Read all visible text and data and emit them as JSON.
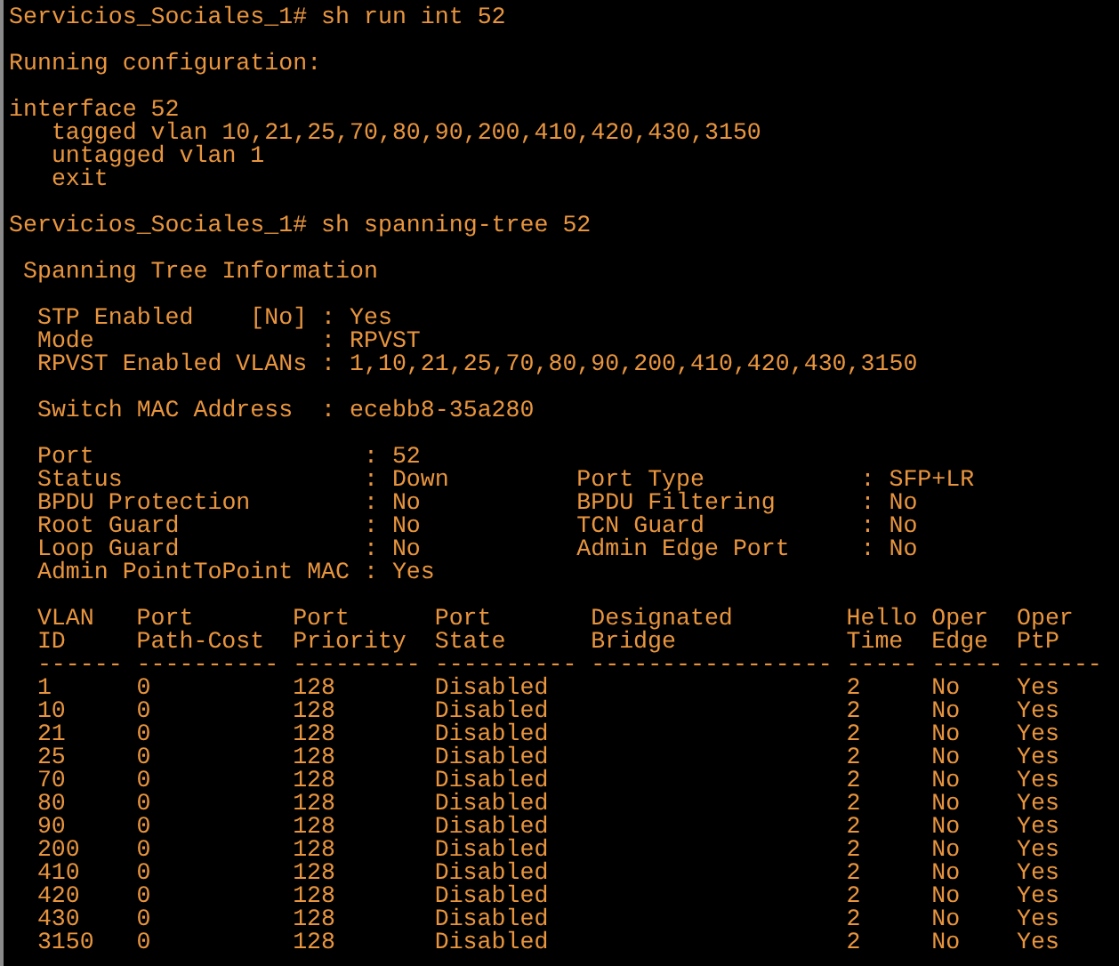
{
  "lines": [
    {
      "kind": "text",
      "text": "Servicios_Sociales_1# sh run int 52"
    },
    {
      "kind": "blank"
    },
    {
      "kind": "text",
      "text": "Running configuration:"
    },
    {
      "kind": "blank"
    },
    {
      "kind": "text",
      "text": "interface 52"
    },
    {
      "kind": "text",
      "text": "   tagged vlan 10,21,25,70,80,90,200,410,420,430,3150"
    },
    {
      "kind": "text",
      "text": "   untagged vlan 1"
    },
    {
      "kind": "text",
      "text": "   exit"
    },
    {
      "kind": "blank"
    },
    {
      "kind": "text",
      "text": "Servicios_Sociales_1# sh spanning-tree 52"
    },
    {
      "kind": "blank"
    },
    {
      "kind": "text",
      "text": " Spanning Tree Information"
    },
    {
      "kind": "blank"
    },
    {
      "kind": "text",
      "text": "  STP Enabled    [No] : Yes"
    },
    {
      "kind": "text",
      "text": "  Mode                : RPVST"
    },
    {
      "kind": "text",
      "text": "  RPVST Enabled VLANs : 1,10,21,25,70,80,90,200,410,420,430,3150"
    },
    {
      "kind": "blank"
    },
    {
      "kind": "text",
      "text": "  Switch MAC Address  : ecebb8-35a280"
    },
    {
      "kind": "blank"
    },
    {
      "kind": "text",
      "text": "  Port                   : 52"
    },
    {
      "kind": "text",
      "text": "  Status                 : Down         Port Type           : SFP+LR"
    },
    {
      "kind": "text",
      "text": "  BPDU Protection        : No           BPDU Filtering      : No"
    },
    {
      "kind": "text",
      "text": "  Root Guard             : No           TCN Guard           : No"
    },
    {
      "kind": "text",
      "text": "  Loop Guard             : No           Admin Edge Port     : No"
    },
    {
      "kind": "text",
      "text": "  Admin PointToPoint MAC : Yes"
    },
    {
      "kind": "blank"
    }
  ],
  "table": {
    "header_rows": [
      [
        "VLAN",
        "Port",
        "Port",
        "Port",
        "Designated",
        "Hello",
        "Oper",
        "Oper"
      ],
      [
        "ID",
        "Path-Cost",
        "Priority",
        "State",
        "Bridge",
        "Time",
        "Edge",
        "PtP"
      ]
    ],
    "separator": "------ ---------- --------- ---------- ----------------- ----- ----- ------",
    "rows": [
      [
        "1",
        "0",
        "128",
        "Disabled",
        "",
        "2",
        "No",
        "Yes"
      ],
      [
        "10",
        "0",
        "128",
        "Disabled",
        "",
        "2",
        "No",
        "Yes"
      ],
      [
        "21",
        "0",
        "128",
        "Disabled",
        "",
        "2",
        "No",
        "Yes"
      ],
      [
        "25",
        "0",
        "128",
        "Disabled",
        "",
        "2",
        "No",
        "Yes"
      ],
      [
        "70",
        "0",
        "128",
        "Disabled",
        "",
        "2",
        "No",
        "Yes"
      ],
      [
        "80",
        "0",
        "128",
        "Disabled",
        "",
        "2",
        "No",
        "Yes"
      ],
      [
        "90",
        "0",
        "128",
        "Disabled",
        "",
        "2",
        "No",
        "Yes"
      ],
      [
        "200",
        "0",
        "128",
        "Disabled",
        "",
        "2",
        "No",
        "Yes"
      ],
      [
        "410",
        "0",
        "128",
        "Disabled",
        "",
        "2",
        "No",
        "Yes"
      ],
      [
        "420",
        "0",
        "128",
        "Disabled",
        "",
        "2",
        "No",
        "Yes"
      ],
      [
        "430",
        "0",
        "128",
        "Disabled",
        "",
        "2",
        "No",
        "Yes"
      ],
      [
        "3150",
        "0",
        "128",
        "Disabled",
        "",
        "2",
        "No",
        "Yes"
      ]
    ]
  }
}
